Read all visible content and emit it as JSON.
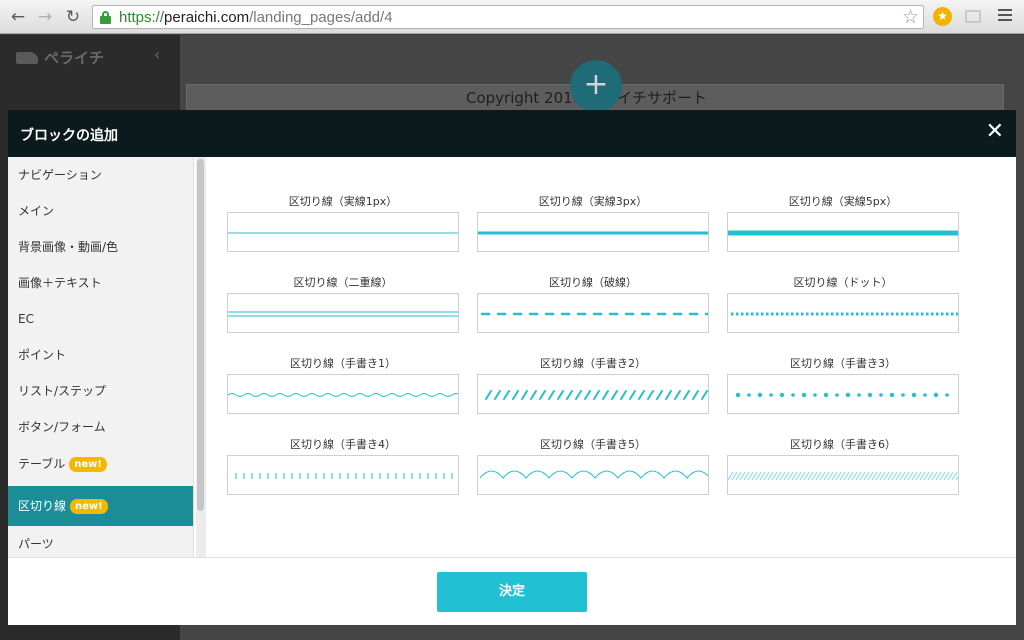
{
  "browser": {
    "url_protocol": "https://",
    "url_host": "peraichi.com",
    "url_path": "/landing_pages/add/4",
    "back_icon": "back-arrow-icon",
    "forward_icon": "forward-arrow-icon",
    "reload_icon": "reload-icon"
  },
  "background_app": {
    "logo": "ペライチ",
    "copyright": "Copyright 2016 ペライチサポート"
  },
  "modal": {
    "title": "ブロックの追加",
    "close_icon": "close-icon",
    "confirm_label": "決定",
    "accent_color": "#21c0d2",
    "active_color": "#1a8d99",
    "badge_color": "#f5b800",
    "categories": [
      {
        "label": "ナビゲーション",
        "badge": ""
      },
      {
        "label": "メイン",
        "badge": ""
      },
      {
        "label": "背景画像・動画/色",
        "badge": ""
      },
      {
        "label": "画像＋テキスト",
        "badge": ""
      },
      {
        "label": "EC",
        "badge": ""
      },
      {
        "label": "ポイント",
        "badge": ""
      },
      {
        "label": "リスト/ステップ",
        "badge": ""
      },
      {
        "label": "ボタン/フォーム",
        "badge": ""
      },
      {
        "label": "テーブル",
        "badge": "new!"
      },
      {
        "label": "区切り線",
        "badge": "new!",
        "active": true
      },
      {
        "label": "パーツ",
        "badge": ""
      }
    ],
    "dividers": [
      {
        "label": "区切り線（実線1px）",
        "style": "solid-1"
      },
      {
        "label": "区切り線（実線3px）",
        "style": "solid-3"
      },
      {
        "label": "区切り線（実線5px）",
        "style": "solid-5"
      },
      {
        "label": "区切り線（二重線）",
        "style": "double"
      },
      {
        "label": "区切り線（破線）",
        "style": "dashed"
      },
      {
        "label": "区切り線（ドット）",
        "style": "dotted"
      },
      {
        "label": "区切り線（手書き1）",
        "style": "hand-wave"
      },
      {
        "label": "区切り線（手書き2）",
        "style": "hand-slash"
      },
      {
        "label": "区切り線（手書き3）",
        "style": "hand-dots"
      },
      {
        "label": "区切り線（手書き4）",
        "style": "hand-ticks"
      },
      {
        "label": "区切り線（手書き5）",
        "style": "hand-scallop"
      },
      {
        "label": "区切り線（手書き6）",
        "style": "hand-hatch"
      }
    ]
  }
}
